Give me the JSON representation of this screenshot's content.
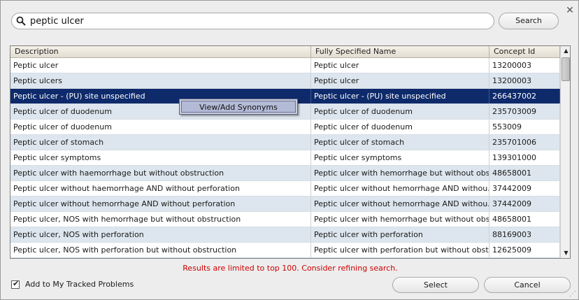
{
  "search": {
    "value": "peptic ulcer",
    "button_label": "Search"
  },
  "icons": {
    "close": "close-icon",
    "search": "search-icon",
    "scroll_up": "chevron-up-icon",
    "scroll_down": "chevron-down-icon",
    "resize": "resize-grip-icon"
  },
  "table": {
    "columns": [
      "Description",
      "Fully Specified Name",
      "Concept Id"
    ],
    "rows": [
      [
        "Peptic ulcer",
        "Peptic ulcer",
        "13200003"
      ],
      [
        "Peptic ulcers",
        "Peptic ulcer",
        "13200003"
      ],
      [
        "Peptic ulcer - (PU) site unspecified",
        "Peptic ulcer - (PU) site unspecified",
        "266437002"
      ],
      [
        "Peptic ulcer of duodenum",
        "Peptic ulcer of duodenum",
        "235703009"
      ],
      [
        "Peptic ulcer of duodenum",
        "Peptic ulcer of duodenum",
        "553009"
      ],
      [
        "Peptic ulcer of stomach",
        "Peptic ulcer of stomach",
        "235701006"
      ],
      [
        "Peptic ulcer symptoms",
        "Peptic ulcer symptoms",
        "139301000"
      ],
      [
        "Peptic ulcer with haemorrhage but without obstruction",
        "Peptic ulcer with hemorrhage but without obs...",
        "48658001"
      ],
      [
        "Peptic ulcer without haemorrhage AND without perforation",
        "Peptic ulcer without hemorrhage AND withou...",
        "37442009"
      ],
      [
        "Peptic ulcer without hemorrhage AND without perforation",
        "Peptic ulcer without hemorrhage AND withou...",
        "37442009"
      ],
      [
        "Peptic ulcer, NOS with hemorrhage but without obstruction",
        "Peptic ulcer with hemorrhage but without obs...",
        "48658001"
      ],
      [
        "Peptic ulcer, NOS with perforation",
        "Peptic ulcer with perforation",
        "88169003"
      ],
      [
        "Peptic ulcer, NOS with perforation but without obstruction",
        "Peptic ulcer with perforation but without obst...",
        "12625009"
      ]
    ],
    "selected_index": 2
  },
  "context_menu": {
    "item": "View/Add Synonyms"
  },
  "limit_message": "Results are limited to top 100. Consider refining search.",
  "tracked": {
    "label": "Add to My Tracked Problems",
    "checked": true
  },
  "buttons": {
    "select": "Select",
    "cancel": "Cancel"
  },
  "colors": {
    "selection": "#0e2a6b",
    "alt_row": "#dde6ee",
    "message": "#cc0000"
  }
}
